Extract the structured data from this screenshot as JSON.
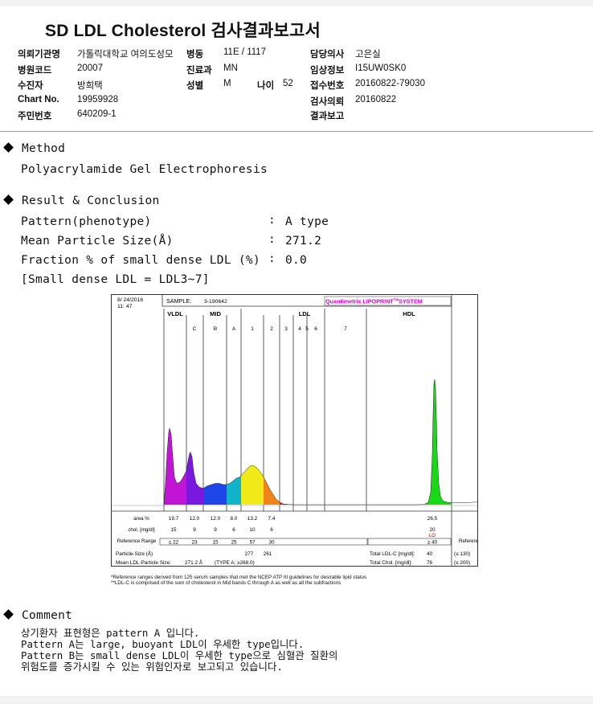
{
  "report": {
    "title": "SD LDL Cholesterol 검사결과보고서",
    "labels": {
      "institution": "의뢰기관명",
      "hospital_code": "병원코드",
      "recipient": "수진자",
      "chart_no": "Chart No.",
      "resident_no": "주민번호",
      "ward": "병동",
      "department": "진료과",
      "sex": "성별",
      "age": "나이",
      "doctor": "담당의사",
      "clinical_info": "임상정보",
      "receipt_no": "접수번호",
      "request_date": "검사의뢰",
      "result_report": "결과보고"
    },
    "values": {
      "institution": "가톨릭대학교 여의도성모",
      "hospital_code": "20007",
      "recipient": "방희택",
      "chart_no": "19959928",
      "resident_no": "640209-1",
      "ward": "11E / 1117",
      "department": "MN",
      "sex": "M",
      "age": "52",
      "doctor": "고은실",
      "clinical_info": "I15UW0SK0",
      "receipt_no": "20160822-79030",
      "request_date": "20160822",
      "result_report": ""
    }
  },
  "method": {
    "heading": "Method",
    "text": "Polyacrylamide Gel Electrophoresis"
  },
  "result": {
    "heading": "Result & Conclusion",
    "rows": [
      {
        "label": "Pattern(phenotype)",
        "sep": ":",
        "value": "A type"
      },
      {
        "label": "Mean Particle Size(Å)",
        "sep": ":",
        "value": "271.2"
      },
      {
        "label": "Fraction % of small dense LDL (%)",
        "sep": ":",
        "value": "0.0"
      }
    ],
    "note": "[Small dense LDL = LDL3~7]"
  },
  "chart_data": {
    "type": "area",
    "date": "8/ 24/2016",
    "time": "11: 47",
    "sample_label": "SAMPLE:",
    "sample_id": "3-190642",
    "brand": "Quantimetrix LIPOPRINT",
    "brand_tm": "TM",
    "brand_suffix": "SYSTEM",
    "bands": [
      "VLDL",
      "MID",
      "LDL",
      "HDL"
    ],
    "mid_sub": [
      "C",
      "B",
      "A"
    ],
    "ldl_sub": [
      "1",
      "2",
      "3",
      "4",
      "5",
      "6",
      "7"
    ],
    "table": {
      "area_label": "area %",
      "area_values": [
        "19.7",
        "12.0",
        "12.0",
        "8.0",
        "13.2",
        "7.4"
      ],
      "hdl_area": "26.5",
      "chol_label": "chol. [mg/dl]",
      "chol_values": [
        "15",
        "9",
        "9",
        "6",
        "10",
        "6"
      ],
      "hdl_chol": "20",
      "hdl_flag": "LO",
      "ref_label": "Reference Range",
      "ref_values": [
        "≤ 22",
        "23",
        "15",
        "25",
        "57",
        "30"
      ],
      "hdl_ref": "≥ 40",
      "ref_label_right": "Reference Range",
      "particle_label": "Particle-Size (Å)",
      "particle_values": [
        "277",
        "261"
      ],
      "mean_label": "Mean LDL-Particle Size:",
      "mean_value": "271.2 Å",
      "mean_type": "(TYPE A; ≥268.0)",
      "total_ldl_label": "Total LDL-C [mg/dl]:",
      "total_ldl_value": "40",
      "total_ldl_ref": "(≤ 130)",
      "total_chol_label": "Total Chol. [mg/dl]:",
      "total_chol_value": "76",
      "total_chol_ref": "(≤ 200)"
    },
    "colors": {
      "vldl": "#c214d4",
      "midc": "#7a18e0",
      "midb": "#1f46e8",
      "mida": "#10b4c8",
      "ldl1": "#f2ea18",
      "ldl2": "#f08418",
      "ldl3": "#e01848",
      "hdl": "#18d818",
      "brand": "#cc00cc"
    },
    "footnotes": [
      "*Reference ranges derived from 125 serum samples that met the NCEP ATP III guidelines for desirable lipid status",
      "**LDL-C is comprised of the sum of cholesterol in Mid bands C through A as well as all the subfractions"
    ]
  },
  "comment": {
    "heading": "Comment",
    "lines": [
      "상기환자 표현형은 pattern A 입니다.",
      "Pattern A는 large, buoyant LDL이 우세한 type입니다.",
      "Pattern B는 small dense LDL이 우세한 type으로 심혈관 질환의",
      "위험도를 증가시킬 수 있는 위험인자로 보고되고 있습니다."
    ]
  }
}
